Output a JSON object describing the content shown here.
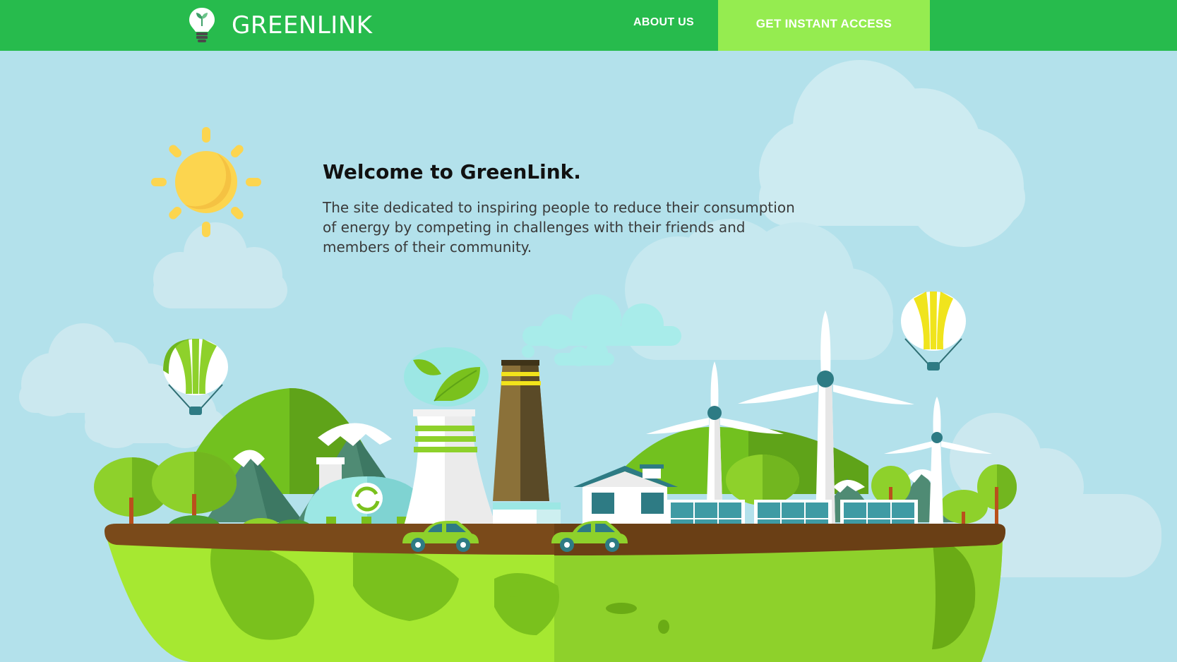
{
  "header": {
    "brand_name": "GREENLINK",
    "nav": {
      "about_label": "ABOUT US",
      "cta_label": "GET INSTANT ACCESS"
    }
  },
  "hero": {
    "title": "Welcome to GreenLink.",
    "description": "The site dedicated to inspiring people to reduce their consumption of energy by competing in challenges with their friends and members of their community."
  },
  "colors": {
    "nav_bg": "#27bb4d",
    "cta_bg": "#95ec50",
    "sky": "#b3e1eb",
    "earth_green": "#7ed321",
    "soil": "#7a4a1a",
    "sun": "#fcd54f"
  },
  "icons": {
    "logo": "lightbulb-leaf-icon"
  }
}
